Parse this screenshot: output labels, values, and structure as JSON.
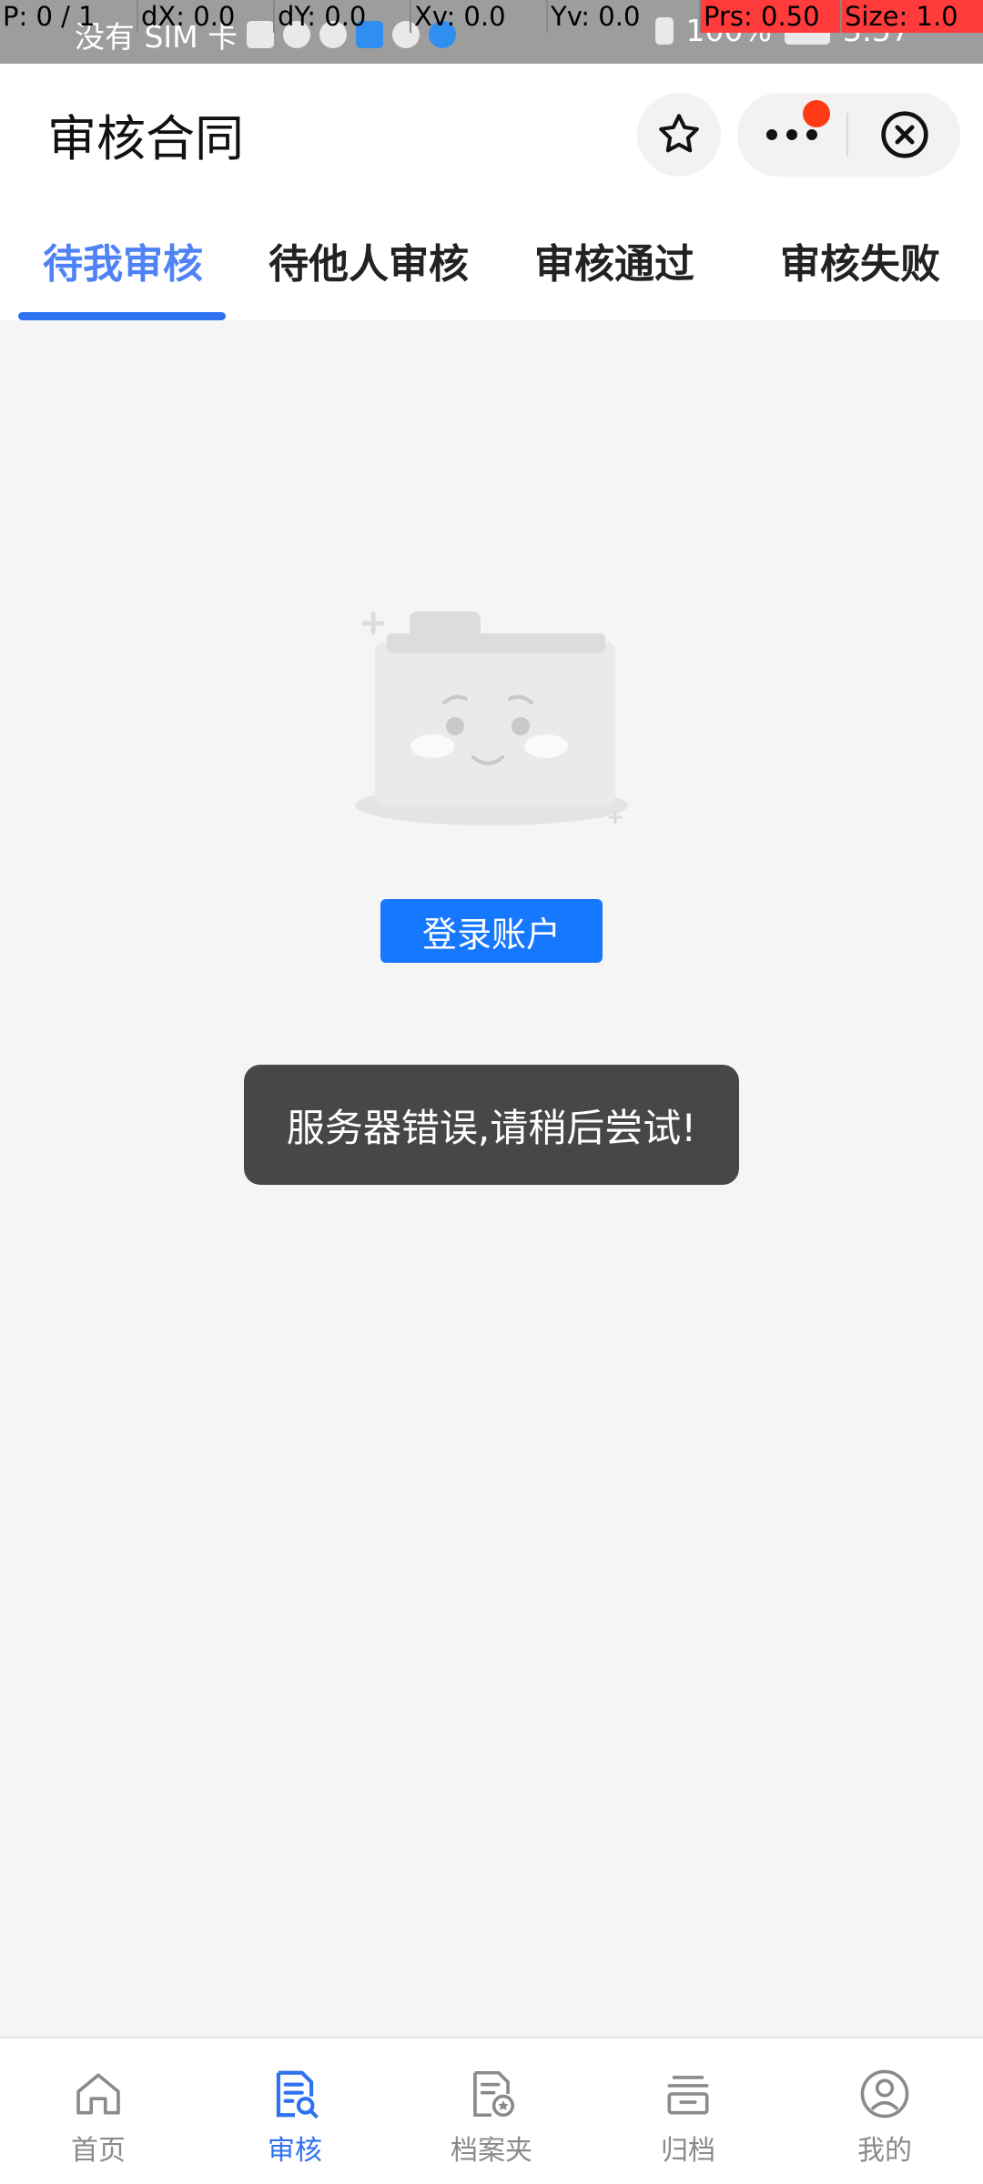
{
  "status_bar": {
    "carrier": "没有 SIM 卡",
    "battery": "100%",
    "time": "3:57"
  },
  "pointer_overlay": {
    "p": "P: 0 / 1",
    "dx": "dX: 0.0",
    "dy": "dY: 0.0",
    "xv": "Xv: 0.0",
    "yv": "Yv: 0.0",
    "prs": "Prs: 0.50",
    "size": "Size: 1.0"
  },
  "header": {
    "title": "审核合同"
  },
  "tabs": [
    {
      "label": "待我审核",
      "active": true
    },
    {
      "label": "待他人审核",
      "active": false
    },
    {
      "label": "审核通过",
      "active": false
    },
    {
      "label": "审核失败",
      "active": false
    }
  ],
  "main": {
    "login_button": "登录账户"
  },
  "toast": {
    "message": "服务器错误,请稍后尝试!"
  },
  "bottom_nav": [
    {
      "label": "首页",
      "icon": "home-icon",
      "active": false
    },
    {
      "label": "审核",
      "icon": "review-icon",
      "active": true
    },
    {
      "label": "档案夹",
      "icon": "archive-folder-icon",
      "active": false
    },
    {
      "label": "归档",
      "icon": "archive-box-icon",
      "active": false
    },
    {
      "label": "我的",
      "icon": "profile-icon",
      "active": false
    }
  ],
  "colors": {
    "accent": "#2f72f0",
    "active_tab_text": "#4f82f5",
    "button": "#1677ff",
    "toast_bg": "#474747",
    "badge": "#ff3b16"
  }
}
